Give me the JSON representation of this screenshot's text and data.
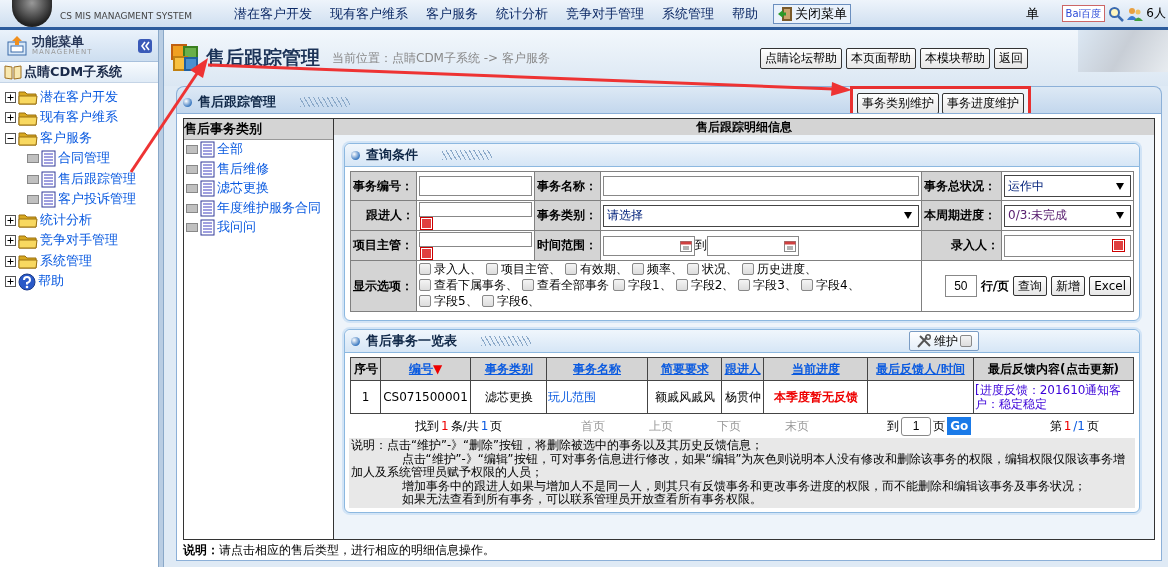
{
  "top_bar": {
    "system_subtitle": "CS MIS MANAGMENT SYSTEM",
    "menu": [
      "潜在客户开发",
      "现有客户维系",
      "客户服务",
      "统计分析",
      "竞争对手管理",
      "系统管理",
      "帮助"
    ],
    "close_menu_button": "关闭菜单",
    "user_text": "单",
    "search_logo": "Bai百度",
    "online_count": "6人"
  },
  "sidebar": {
    "title": "功能菜单",
    "subtitle": "MANAGEMENT",
    "system": "点睛CDM子系统",
    "tree": [
      {
        "label": "潜在客户开发",
        "kind": "folder",
        "expanded": false
      },
      {
        "label": "现有客户维系",
        "kind": "folder",
        "expanded": false
      },
      {
        "label": "客户服务",
        "kind": "folder",
        "expanded": true,
        "children": [
          {
            "label": "合同管理",
            "kind": "page"
          },
          {
            "label": "售后跟踪管理",
            "kind": "page"
          },
          {
            "label": "客户投诉管理",
            "kind": "page"
          }
        ]
      },
      {
        "label": "统计分析",
        "kind": "folder",
        "expanded": false
      },
      {
        "label": "竞争对手管理",
        "kind": "folder",
        "expanded": false
      },
      {
        "label": "系统管理",
        "kind": "folder",
        "expanded": false
      },
      {
        "label": "帮助",
        "kind": "help",
        "expanded": false
      }
    ]
  },
  "header": {
    "title": "售后跟踪管理",
    "breadcrumb": "当前位置：点睛CDM子系统 -> 客户服务",
    "help_buttons": [
      "点睛论坛帮助",
      "本页面帮助",
      "本模块帮助",
      "返回"
    ]
  },
  "panel": {
    "title": "售后跟踪管理",
    "tab_buttons": [
      "事务类别维护",
      "事务进度维护"
    ],
    "category_heading": "售后事务类别",
    "categories": [
      "全部",
      "售后维修",
      "滤芯更换",
      "年度维护服务合同",
      "我问问"
    ],
    "detail_heading": "售后跟踪明细信息"
  },
  "query": {
    "title": "查询条件",
    "row1": {
      "code_label": "事务编号：",
      "name_label": "事务名称：",
      "status_label": "事务总状况：",
      "status_value": "运作中"
    },
    "row2": {
      "follower_label": "跟进人：",
      "category_label": "事务类别：",
      "category_value": "请选择",
      "progress_label": "本周期进度：",
      "progress_value": "0/3:未完成"
    },
    "row3": {
      "manager_label": "项目主管：",
      "time_label": "时间范围：",
      "to_label": "到",
      "entry_label": "录入人："
    },
    "options_label": "显示选项：",
    "options": [
      {
        "label": "录入人、",
        "checked": false
      },
      {
        "label": "项目主管、",
        "checked": false
      },
      {
        "label": "有效期、",
        "checked": false
      },
      {
        "label": "频率、",
        "checked": false
      },
      {
        "label": "状况、",
        "checked": false
      },
      {
        "label": "历史进度、",
        "checked": false
      },
      {
        "label": "查看下属事务、",
        "checked": false
      },
      {
        "label": "查看全部事务",
        "checked": false
      },
      {
        "label": "字段1、",
        "checked": false
      },
      {
        "label": "字段2、",
        "checked": false
      },
      {
        "label": "字段3、",
        "checked": false
      },
      {
        "label": "字段4、",
        "checked": false
      },
      {
        "label": "字段5、",
        "checked": false
      },
      {
        "label": "字段6、",
        "checked": false
      }
    ],
    "rows_per_page": "50",
    "rows_per_page_unit": "行/页",
    "buttons": [
      "查询",
      "新增",
      "Excel"
    ]
  },
  "list": {
    "title": "售后事务一览表",
    "maintain_button": {
      "label": "维护",
      "checked": false
    },
    "columns": [
      {
        "label": "序号",
        "linked": false
      },
      {
        "label": "编号",
        "linked": true,
        "sort_mark": "▼"
      },
      {
        "label": "事务类别",
        "linked": true
      },
      {
        "label": "事务名称",
        "linked": true
      },
      {
        "label": "简要要求",
        "linked": true
      },
      {
        "label": "跟进人",
        "linked": true
      },
      {
        "label": "当前进度",
        "linked": true
      },
      {
        "label": "最后反馈人/时间",
        "linked": true
      },
      {
        "label": "最后反馈内容(点击更新)",
        "linked": false
      }
    ],
    "rows": [
      {
        "cells": [
          {
            "text": "1",
            "kind": "plain"
          },
          {
            "text": "CS071500001",
            "kind": "plain"
          },
          {
            "text": "滤芯更换",
            "kind": "plain"
          },
          {
            "text": "玩儿范围",
            "kind": "link"
          },
          {
            "text": "额戚风戚风",
            "kind": "plain"
          },
          {
            "text": "杨贯仲",
            "kind": "plain"
          },
          {
            "text": "本季度暂无反馈",
            "kind": "alert"
          },
          {
            "kind": "blank"
          },
          {
            "text": "[进度反馈：201610通知客户：稳定稳定",
            "kind": "feedback"
          }
        ]
      }
    ]
  },
  "pagination": {
    "summary": [
      {
        "text": "找到",
        "kind": "label"
      },
      {
        "text": "1",
        "kind": "count"
      },
      {
        "text": "条/共",
        "kind": "label"
      },
      {
        "text": "1",
        "kind": "pages"
      },
      {
        "text": "页",
        "kind": "label"
      }
    ],
    "nav": [
      {
        "label": "首页",
        "disabled": true
      },
      {
        "label": "上页",
        "disabled": true
      },
      {
        "label": "下页",
        "disabled": true
      },
      {
        "label": "末页",
        "disabled": true
      }
    ],
    "goto_label": "到",
    "goto_value": "1",
    "goto_unit": "页",
    "go_button": "Go",
    "page_info": [
      {
        "text": "第",
        "kind": "label"
      },
      {
        "text": "1",
        "kind": "count"
      },
      {
        "text": "/1",
        "kind": "pages"
      },
      {
        "text": "页",
        "kind": "label"
      }
    ]
  },
  "notes": [
    {
      "text": "说明：点击“维护”-》“删除”按钮，将删除被选中的事务以及其历史反馈信息；",
      "kind": "lead"
    },
    {
      "text": "点击“维护”-》“编辑”按钮，可对事务信息进行修改，如果“编辑”为灰色则说明本人没有修改和删除该事务的权限，编辑权限仅限该事务增加人及系统管理员赋予权限的人员；",
      "kind": "indent"
    },
    {
      "text": "增加事务中的跟进人如果与增加人不是同一人，则其只有反馈事务和更改事务进度的权限，而不能删除和编辑该事务及事务状况；",
      "kind": "indent2"
    },
    {
      "text": "如果无法查看到所有事务，可以联系管理员开放查看所有事务权限。",
      "kind": "indent2"
    }
  ],
  "footer_note": "**说明：**请点击相应的售后类型，进行相应的明细信息操作。"
}
